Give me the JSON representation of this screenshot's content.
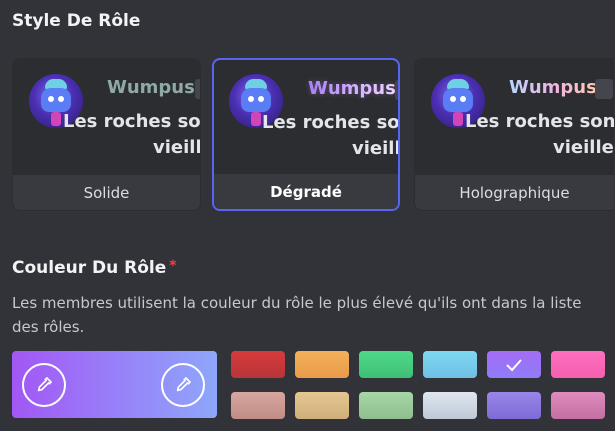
{
  "role_style": {
    "title": "Style De Rôle",
    "preview": {
      "username": "Wumpus",
      "message_line1": "Les roches sont",
      "message_line2": "vieilles"
    },
    "options": [
      {
        "label": "Solide",
        "selected": false
      },
      {
        "label": "Dégradé",
        "selected": true
      },
      {
        "label": "Holographique",
        "selected": false
      }
    ]
  },
  "role_color": {
    "title": "Couleur Du Rôle",
    "required_marker": "*",
    "description": "Les membres utilisent la couleur du rôle le plus élevé qu'ils ont dans la liste des rôles.",
    "custom_gradient": {
      "start": "#a257f5",
      "end": "#8ea7fb"
    },
    "swatch_rows": [
      [
        {
          "colors": [
            "#d73a3a",
            "#b7353a"
          ],
          "selected": false
        },
        {
          "colors": [
            "#f4b05a",
            "#e99b4b"
          ],
          "selected": false
        },
        {
          "colors": [
            "#4fd98a",
            "#3fbf75"
          ],
          "selected": false
        },
        {
          "colors": [
            "#7ed8f0",
            "#6fbfe6"
          ],
          "selected": false
        },
        {
          "colors": [
            "#a46cf6",
            "#8f7cf8"
          ],
          "selected": true
        },
        {
          "colors": [
            "#ff6fbf",
            "#f55fb0"
          ],
          "selected": false
        }
      ],
      [
        {
          "colors": [
            "#d7a79f",
            "#bf8d86"
          ],
          "selected": false
        },
        {
          "colors": [
            "#e6c791",
            "#cfb07a"
          ],
          "selected": false
        },
        {
          "colors": [
            "#a7d7a7",
            "#8fbf8f"
          ],
          "selected": false
        },
        {
          "colors": [
            "#dfe6ef",
            "#bfc9d6"
          ],
          "selected": false
        },
        {
          "colors": [
            "#9a86e8",
            "#7f6bd6"
          ],
          "selected": false
        },
        {
          "colors": [
            "#e08bbd",
            "#c46fa3"
          ],
          "selected": false
        }
      ]
    ]
  }
}
